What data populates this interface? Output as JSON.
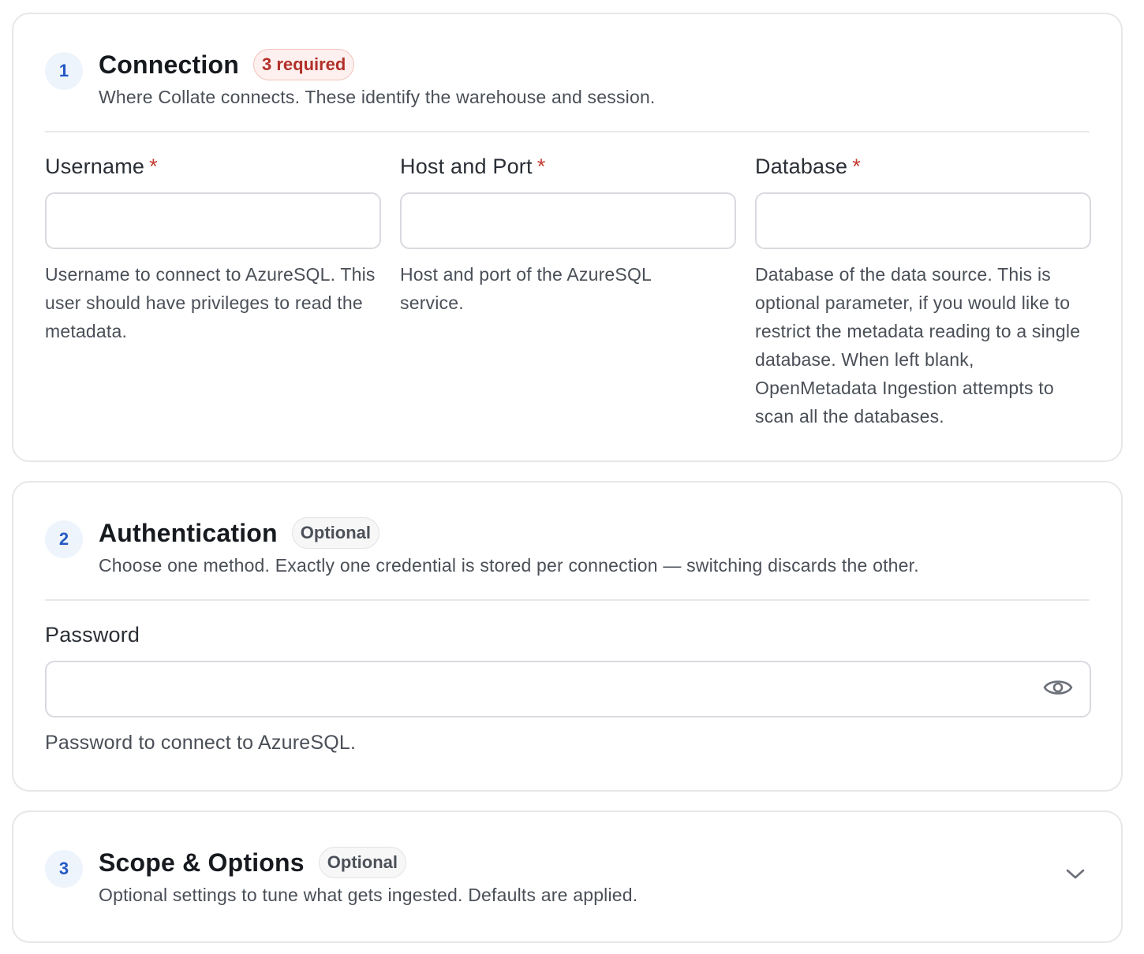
{
  "sections": [
    {
      "step": "1",
      "title": "Connection",
      "badge": "3 required",
      "subtitle": "Where Collate connects. These identify the warehouse and session.",
      "fields": [
        {
          "label": "Username",
          "required_mark": "*",
          "value": "",
          "help": "Username to connect to AzureSQL. This user should have privileges to read the metadata."
        },
        {
          "label": "Host and Port",
          "required_mark": "*",
          "value": "",
          "help": "Host and port of the AzureSQL service."
        },
        {
          "label": "Database",
          "required_mark": "*",
          "value": "",
          "help": "Database of the data source. This is optional parameter, if you would like to restrict the metadata reading to a single database. When left blank, OpenMetadata Ingestion attempts to scan all the databases."
        }
      ]
    },
    {
      "step": "2",
      "title": "Authentication",
      "badge": "Optional",
      "subtitle": "Choose one method. Exactly one credential is stored per connection — switching discards the other.",
      "fields": [
        {
          "label": "Password",
          "value": "",
          "help": "Password to connect to AzureSQL.",
          "icon": "eye-icon"
        }
      ]
    },
    {
      "step": "3",
      "title": "Scope & Options",
      "badge": "Optional",
      "subtitle": "Optional settings to tune what gets ingested. Defaults are applied.",
      "icon": "chevron-down-icon"
    }
  ]
}
